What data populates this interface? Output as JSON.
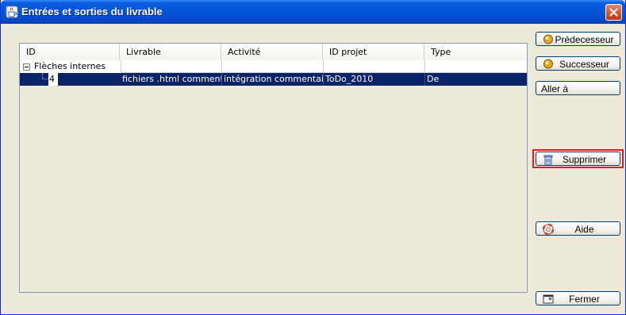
{
  "window": {
    "title": "Entrées et sorties du livrable"
  },
  "table": {
    "columns": [
      "ID",
      "Livrable",
      "Activité",
      "ID projet",
      "Type"
    ],
    "group": {
      "label": "Flèches internes"
    },
    "rows": [
      {
        "id": "4",
        "livrable": "fichiers .html commentés",
        "activite": "intégration  commentair...",
        "id_projet": "ToDo_2010",
        "type": "De"
      }
    ]
  },
  "buttons": {
    "predecesseur": "Prédecesseur",
    "successeur": "Successeur",
    "aller_a": "Aller à",
    "supprimer": "Supprimer",
    "aide": "Aide",
    "fermer": "Fermer"
  },
  "colors": {
    "titlebar": "#0455d8",
    "selection": "#0a246a",
    "focus": "#e31a1a",
    "close": "#d3522c"
  },
  "icons": {
    "title": "java-cup-icon",
    "predecesseur": "gold-orb-icon",
    "successeur": "gold-orb-icon",
    "supprimer": "trash-can-icon",
    "aide": "lifebuoy-icon",
    "fermer": "close-window-icon"
  }
}
